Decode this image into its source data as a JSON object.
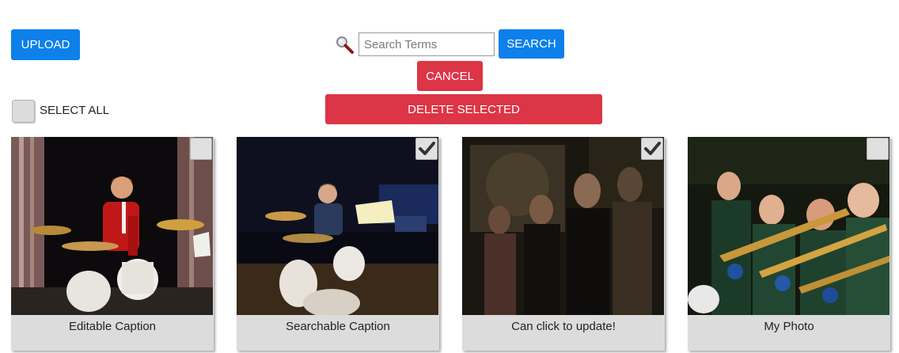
{
  "toolbar": {
    "upload_label": "UPLOAD",
    "search_placeholder": "Search Terms",
    "search_value": "",
    "search_label": "SEARCH",
    "cancel_label": "CANCEL",
    "delete_selected_label": "DELETE SELECTED",
    "select_all_label": "SELECT ALL",
    "select_all_checked": false
  },
  "colors": {
    "primary": "#0d80ea",
    "danger": "#dc3545",
    "caption_bg": "#dcdcdc"
  },
  "photos": [
    {
      "caption": "Editable Caption",
      "selected": false,
      "icon": "photo-drummer-red-jacket"
    },
    {
      "caption": "Searchable Caption",
      "selected": true,
      "icon": "photo-drummer-stage"
    },
    {
      "caption": "Can click to update!",
      "selected": true,
      "icon": "photo-group-dark"
    },
    {
      "caption": "My Photo",
      "selected": false,
      "icon": "photo-trombone-section"
    }
  ]
}
